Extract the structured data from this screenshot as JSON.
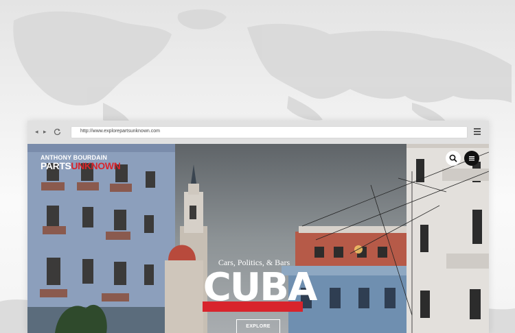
{
  "browser": {
    "url": "http://www.explorepartsunknown.com",
    "back_icon": "back-arrow-icon",
    "forward_icon": "forward-arrow-icon",
    "reload_icon": "reload-icon",
    "menu_icon": "hamburger-menu-icon"
  },
  "site": {
    "logo_line1": "ANTHONY BOURDAIN",
    "logo_parts": "PARTS",
    "logo_unknown": "UNKNOWN",
    "search_icon": "search-icon",
    "menu_icon": "menu-icon"
  },
  "hero": {
    "tagline": "Cars, Politics, & Bars",
    "title": "CUBA",
    "cta": "EXPLORE"
  },
  "colors": {
    "brand_red": "#d8242c",
    "header_dark": "#111111",
    "chrome_gray": "#e1e1e1"
  }
}
